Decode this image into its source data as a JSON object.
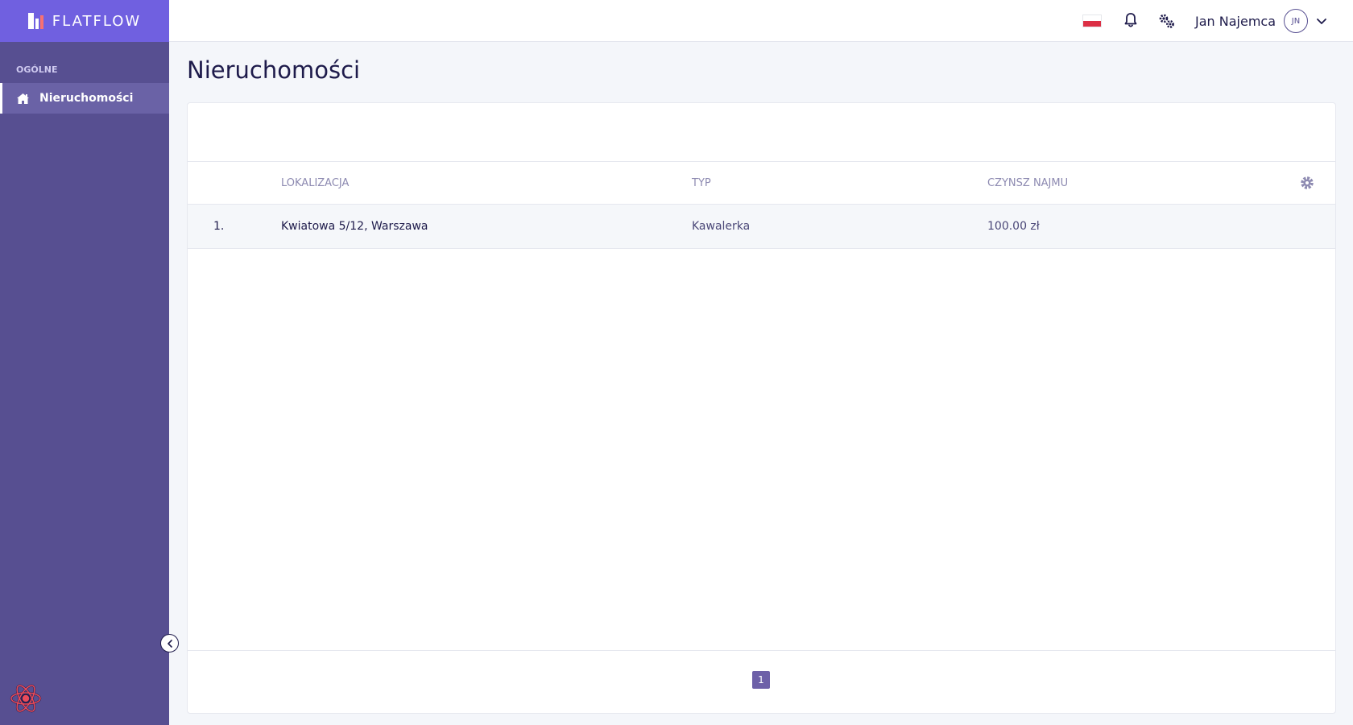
{
  "brand": {
    "name": "FLATFLOW"
  },
  "sidebar": {
    "section_label": "OGÓLNE",
    "items": [
      {
        "label": "Nieruchomości",
        "icon": "home-icon",
        "active": true
      }
    ]
  },
  "topbar": {
    "language_icon": "poland-flag-icon",
    "user_name": "Jan Najemca",
    "avatar_initials": "JN"
  },
  "page": {
    "title": "Nieruchomości"
  },
  "table": {
    "columns": [
      "LOKALIZACJA",
      "TYP",
      "CZYNSZ NAJMU"
    ],
    "rows": [
      {
        "index": "1.",
        "location": "Kwiatowa 5/12, Warszawa",
        "type": "Kawalerka",
        "rent": "100.00 zł"
      }
    ]
  },
  "pagination": {
    "current_page": "1"
  },
  "colors": {
    "sidebar": "#574f91",
    "brand_bar": "#7060e0",
    "accent": "#6d60a8",
    "text_dark": "#1e1b4b",
    "header_text": "#8d8ab1"
  }
}
